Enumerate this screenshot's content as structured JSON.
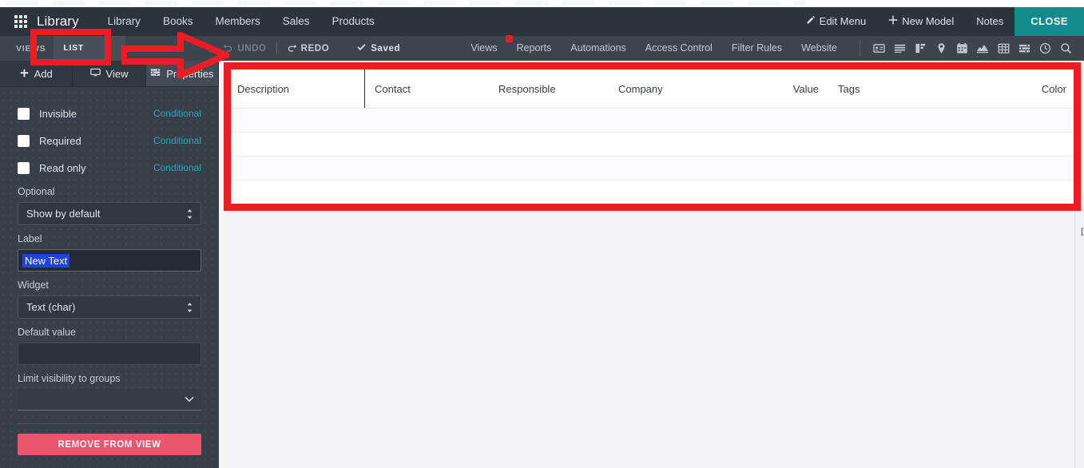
{
  "header": {
    "logo_icon": "grid-apps-icon",
    "brand": "Library",
    "menu": [
      {
        "label": "Library"
      },
      {
        "label": "Books"
      },
      {
        "label": "Members"
      },
      {
        "label": "Sales"
      },
      {
        "label": "Products"
      }
    ],
    "edit_menu": "Edit Menu",
    "edit_menu_icon": "pencil-icon",
    "new_model": "New Model",
    "new_model_icon": "plus-icon",
    "notes": "Notes",
    "close": "CLOSE",
    "close_color": "#118b8b",
    "background": "#2b333d"
  },
  "subbar": {
    "views_label": "VIEWS",
    "active_view": "LIST",
    "undo": "UNDO",
    "undo_icon": "undo-arrow-icon",
    "redo": "REDO",
    "redo_icon": "redo-arrow-icon",
    "saved": "Saved",
    "saved_icon": "check-icon",
    "menu": [
      {
        "label": "Views"
      },
      {
        "label": "Reports"
      },
      {
        "label": "Automations"
      },
      {
        "label": "Access Control"
      },
      {
        "label": "Filter Rules"
      },
      {
        "label": "Website"
      }
    ],
    "view_icons": [
      "kanban-card-icon",
      "list-icon",
      "gantt-icon",
      "map-pin-icon",
      "calendar-icon",
      "graph-area-icon",
      "pivot-grid-icon",
      "form-icon",
      "activity-clock-icon",
      "search-icon"
    ]
  },
  "sidebar": {
    "tabs": [
      {
        "label": "Add",
        "icon": "plus-icon",
        "active": false
      },
      {
        "label": "View",
        "icon": "monitor-icon",
        "active": false
      },
      {
        "label": "Properties",
        "icon": "properties-icon",
        "active": true
      }
    ],
    "checkboxes": [
      {
        "label": "Invisible",
        "conditional": "Conditional",
        "checked": false
      },
      {
        "label": "Required",
        "conditional": "Conditional",
        "checked": false
      },
      {
        "label": "Read only",
        "conditional": "Conditional",
        "checked": false
      }
    ],
    "conditional_color": "#2ea3b8",
    "optional_label": "Optional",
    "optional_value": "Show by default",
    "label_label": "Label",
    "label_value": "New Text",
    "widget_label": "Widget",
    "widget_value": "Text (char)",
    "default_value_label": "Default value",
    "default_value": "",
    "groups_label": "Limit visibility to groups",
    "groups_value": "",
    "remove_button": "REMOVE FROM VIEW",
    "remove_button_color": "#e8556d"
  },
  "table": {
    "columns": [
      {
        "label": "Description",
        "align": "left",
        "selected": true
      },
      {
        "label": "Contact",
        "align": "left",
        "selected": false
      },
      {
        "label": "Responsible",
        "align": "left",
        "selected": false
      },
      {
        "label": "Company",
        "align": "left",
        "selected": false
      },
      {
        "label": "Value",
        "align": "right",
        "selected": false
      },
      {
        "label": "Tags",
        "align": "left",
        "selected": false
      },
      {
        "label": "Color",
        "align": "right",
        "selected": false
      }
    ],
    "rows": [
      [],
      [],
      [],
      []
    ],
    "empty": true
  },
  "annotations": {
    "highlight_color": "#ec1c24",
    "list_tab_box": "rectangle around LIST view tab",
    "table_box": "rectangle around list view table",
    "arrow": "arrow pointing right toward Properties tab",
    "dot": "red dot marker"
  }
}
